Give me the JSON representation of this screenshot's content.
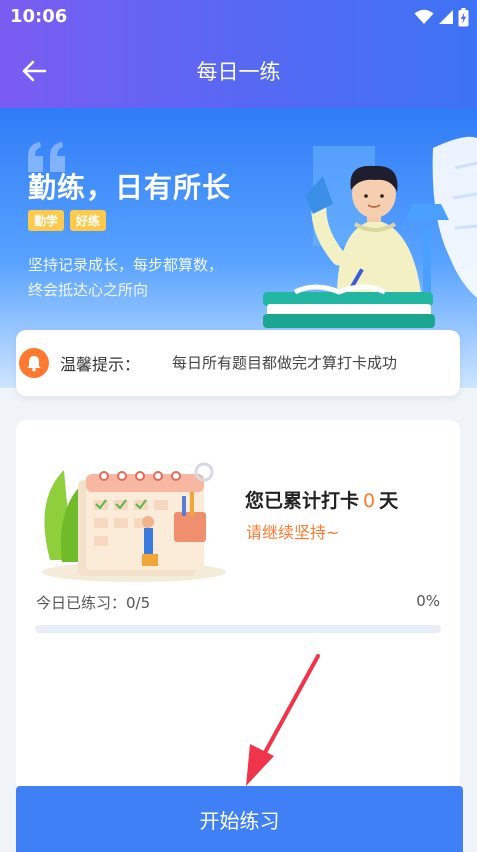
{
  "status_bar": {
    "time": "10:06"
  },
  "nav": {
    "title": "每日一练"
  },
  "hero": {
    "title": "勤练，日有所长",
    "tags": [
      "勤学",
      "好练"
    ],
    "line1": "坚持记录成长，每步都算数，",
    "line2": "终会抵达心之所向"
  },
  "tip": {
    "label": "温馨提示：",
    "text": "每日所有题目都做完才算打卡成功",
    "icon": "bell-icon"
  },
  "progress": {
    "streak_prefix": "您已累计打卡",
    "streak_count": "0",
    "streak_suffix": "天",
    "encourage": "请继续坚持~",
    "today_label": "今日已练习：",
    "today_value": "0/5",
    "percent": "0%",
    "fill_fraction": 0
  },
  "start_button": {
    "label": "开始练习"
  },
  "colors": {
    "primary": "#3f80f6",
    "accent": "#ff7a2e",
    "header_start": "#7b5cf2",
    "header_end": "#3d73f4"
  }
}
